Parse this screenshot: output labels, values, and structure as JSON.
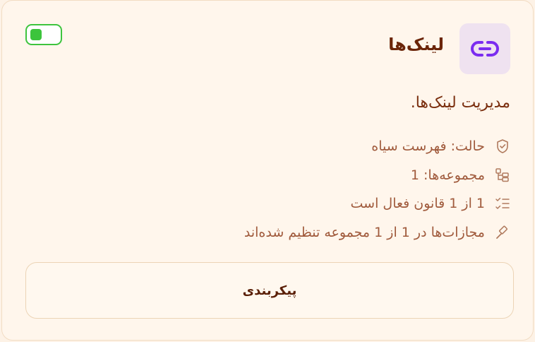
{
  "card": {
    "title": "لینک‌ها",
    "description": "مدیریت لینک‌ها.",
    "toggle_enabled": true,
    "icon": "link-icon",
    "accent_color": "#7b2cf0",
    "toggle_color": "#3cc43c"
  },
  "info": [
    {
      "icon": "shield-check-icon",
      "text": "حالت: فهرست سیاه"
    },
    {
      "icon": "collections-icon",
      "text": "مجموعه‌ها: 1"
    },
    {
      "icon": "list-check-icon",
      "text": "1 از 1 قانون فعال است"
    },
    {
      "icon": "gavel-icon",
      "text": "مجازات‌ها در 1 از 1 مجموعه تنظیم شده‌اند"
    }
  ],
  "button": {
    "label": "پیکربندی"
  }
}
